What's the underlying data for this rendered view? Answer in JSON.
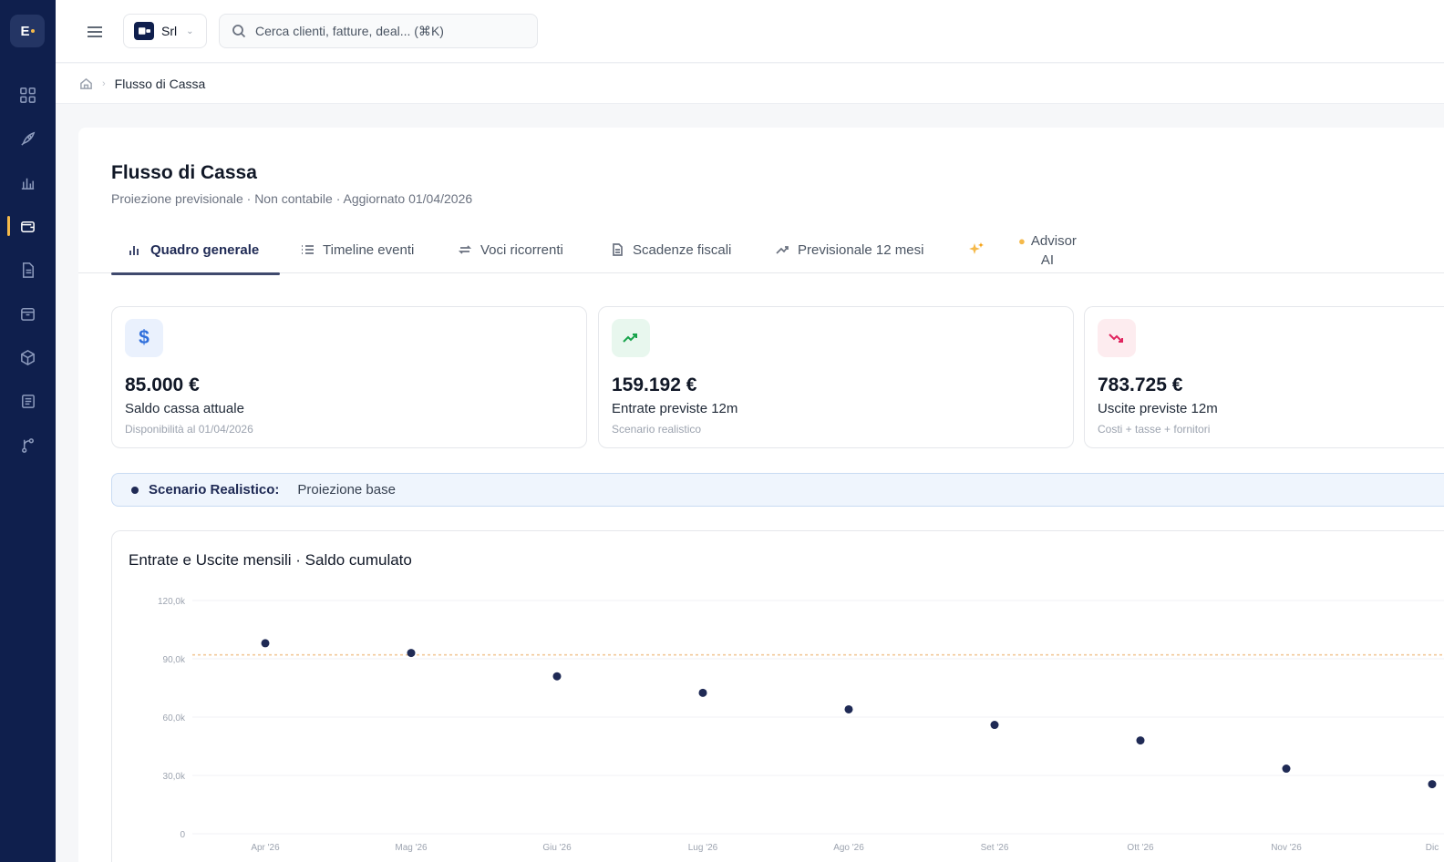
{
  "sidebar": {
    "logo_text": "E",
    "items": [
      {
        "icon": "dashboard-icon",
        "active": false
      },
      {
        "icon": "rocket-icon",
        "active": false
      },
      {
        "icon": "bar-chart-icon",
        "active": false
      },
      {
        "icon": "wallet-icon",
        "active": true
      },
      {
        "icon": "document-icon",
        "active": false
      },
      {
        "icon": "archive-box-icon",
        "active": false
      },
      {
        "icon": "cube-icon",
        "active": false
      },
      {
        "icon": "ledger-icon",
        "active": false
      },
      {
        "icon": "branch-icon",
        "active": false
      }
    ]
  },
  "topbar": {
    "company_label": "Srl",
    "search_placeholder": "Cerca clienti, fatture, deal... (⌘K)"
  },
  "breadcrumb": {
    "current": "Flusso di Cassa"
  },
  "page": {
    "title": "Flusso di Cassa",
    "subtitle": "Proiezione previsionale · Non contabile · Aggiornato 01/04/2026"
  },
  "tabs": [
    {
      "label": "Quadro generale",
      "icon": "bar-chart-icon",
      "active": true
    },
    {
      "label": "Timeline eventi",
      "icon": "list-icon",
      "active": false
    },
    {
      "label": "Voci ricorrenti",
      "icon": "repeat-icon",
      "active": false
    },
    {
      "label": "Scadenze fiscali",
      "icon": "document-icon",
      "active": false
    },
    {
      "label": "Previsionale 12 mesi",
      "icon": "trend-up-icon",
      "active": false
    }
  ],
  "ai_tab": {
    "label_line1": "Advisor",
    "label_line2": "AI"
  },
  "kpis": [
    {
      "value": "85.000 €",
      "label": "Saldo cassa attuale",
      "note": "Disponibilità al 01/04/2026",
      "icon": "dollar-icon",
      "accent": "#2f6fdc",
      "bg": "#eaf1fd"
    },
    {
      "value": "159.192 €",
      "label": "Entrate previste 12m",
      "note": "Scenario realistico",
      "icon": "trend-up-icon",
      "accent": "#16a34a",
      "bg": "#e8f7ee"
    },
    {
      "value": "783.725 €",
      "label": "Uscite previste 12m",
      "note": "Costi + tasse + fornitori",
      "icon": "trend-down-icon",
      "accent": "#e0245e",
      "bg": "#fdecef"
    }
  ],
  "scenario": {
    "name": "Scenario Realistico:",
    "description": "Proiezione base"
  },
  "chart": {
    "title": "Entrate e Uscite mensili · Saldo cumulato"
  },
  "chart_data": {
    "type": "scatter",
    "title": "Entrate e Uscite mensili · Saldo cumulato",
    "categories": [
      "Apr '26",
      "Mag '26",
      "Giu '26",
      "Lug '26",
      "Ago '26",
      "Set '26",
      "Ott '26",
      "Nov '26",
      "Dic"
    ],
    "series": [
      {
        "values": [
          98000,
          93000,
          81000,
          72500,
          64000,
          56000,
          48000,
          33500,
          25500
        ],
        "color": "#1f2a55"
      }
    ],
    "reference_line": {
      "value": 92000,
      "style": "dashed",
      "color": "#f2c99a"
    },
    "yticks": [
      "0",
      "30,0k",
      "60,0k",
      "90,0k",
      "120,0k"
    ],
    "ylim": [
      0,
      120000
    ],
    "grid": true
  }
}
